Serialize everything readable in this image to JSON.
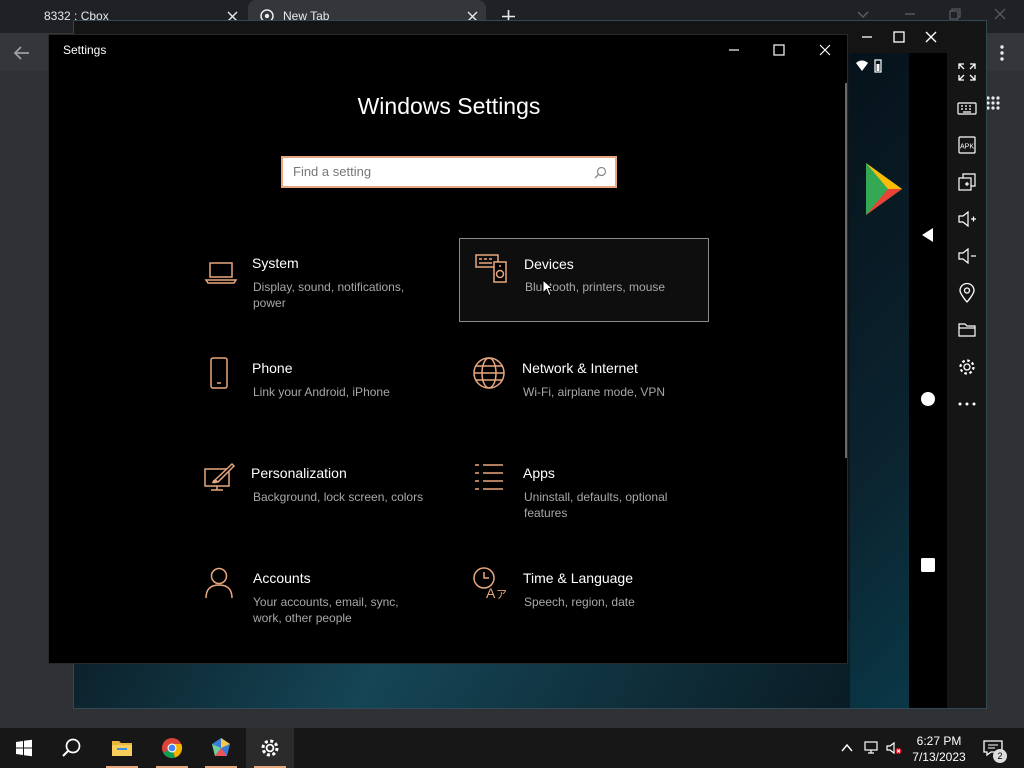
{
  "browser": {
    "tabs": [
      {
        "label": "8332 : Cbox"
      },
      {
        "label": "New Tab"
      }
    ]
  },
  "settings": {
    "window_title": "Settings",
    "heading": "Windows Settings",
    "search": {
      "placeholder": "Find a setting"
    },
    "accent": "#e8a77d",
    "tiles": [
      {
        "title": "System",
        "desc": "Display, sound, notifications, power",
        "icon": "laptop-icon"
      },
      {
        "title": "Devices",
        "desc": "Bluetooth, printers, mouse",
        "icon": "devices-icon"
      },
      {
        "title": "Phone",
        "desc": "Link your Android, iPhone",
        "icon": "phone-icon"
      },
      {
        "title": "Network & Internet",
        "desc": "Wi-Fi, airplane mode, VPN",
        "icon": "globe-icon"
      },
      {
        "title": "Personalization",
        "desc": "Background, lock screen, colors",
        "icon": "personalization-icon"
      },
      {
        "title": "Apps",
        "desc": "Uninstall, defaults, optional features",
        "icon": "apps-list-icon"
      },
      {
        "title": "Accounts",
        "desc": "Your accounts, email, sync, work, other people",
        "icon": "person-icon"
      },
      {
        "title": "Time & Language",
        "desc": "Speech, region, date",
        "icon": "time-language-icon"
      }
    ]
  },
  "taskbar": {
    "time": "6:27 PM",
    "date": "7/13/2023",
    "notification_count": "2"
  }
}
